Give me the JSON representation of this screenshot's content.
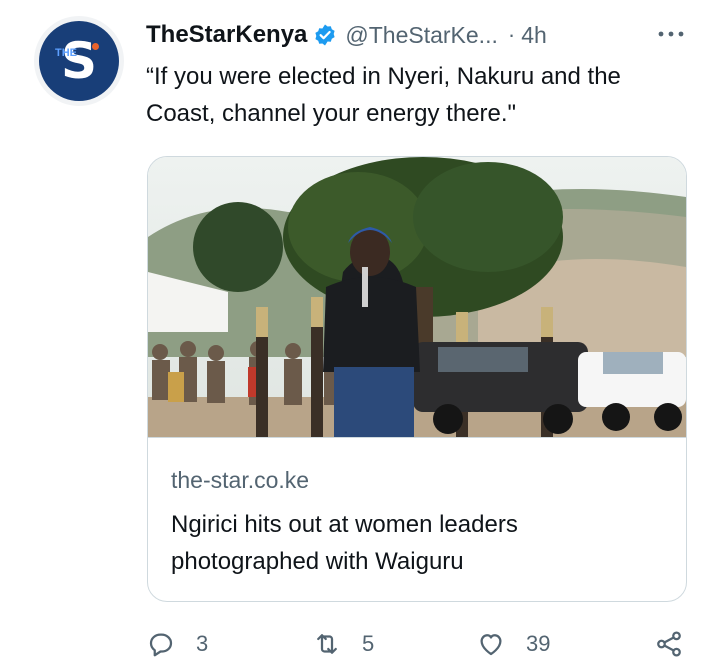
{
  "tweet": {
    "display_name": "TheStarKenya",
    "handle": "@TheStarKe...",
    "separator": "·",
    "time": "4h",
    "text": "“If you were elected in Nyeri, Nakuru and the Coast, channel your energy there.\"",
    "verified": true
  },
  "avatar": {
    "letter": "S",
    "small_text": "THE",
    "bg_color": "#183e78"
  },
  "card": {
    "domain": "the-star.co.ke",
    "title": "Ngirici hits out at women leaders photographed with Waiguru"
  },
  "actions": {
    "replies": "3",
    "retweets": "5",
    "likes": "39"
  },
  "colors": {
    "verified": "#1d9bf0",
    "muted": "#536471",
    "text": "#0f1419",
    "border": "#cfd9de"
  },
  "icons": [
    "verified-badge-icon",
    "more-icon",
    "reply-icon",
    "retweet-icon",
    "like-icon",
    "share-icon"
  ]
}
